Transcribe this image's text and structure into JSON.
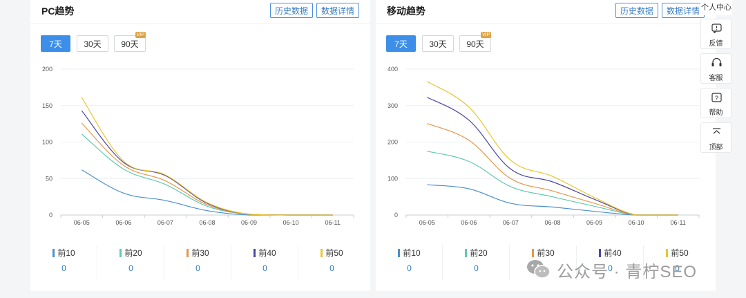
{
  "series_colors": [
    "#4a8fd1",
    "#5fcab0",
    "#e8954a",
    "#4a46a8",
    "#ecc52f"
  ],
  "panels": {
    "pc": {
      "title": "PC趋势",
      "history_button": "历史数据",
      "detail_button": "数据详情",
      "range_tabs": [
        "7天",
        "30天",
        "90天"
      ],
      "active_range": "7天",
      "vip_badge": "VIP",
      "legend": [
        {
          "name": "前10",
          "value": "0"
        },
        {
          "name": "前20",
          "value": "0"
        },
        {
          "name": "前30",
          "value": "0"
        },
        {
          "name": "前40",
          "value": "0"
        },
        {
          "name": "前50",
          "value": "0"
        }
      ]
    },
    "mobile": {
      "title": "移动趋势",
      "history_button": "历史数据",
      "detail_button": "数据详情",
      "range_tabs": [
        "7天",
        "30天",
        "90天"
      ],
      "active_range": "7天",
      "vip_badge": "VIP",
      "legend": [
        {
          "name": "前10",
          "value": "0"
        },
        {
          "name": "前20",
          "value": "0"
        },
        {
          "name": "前30",
          "value": "0"
        },
        {
          "name": "前40",
          "value": "0"
        },
        {
          "name": "前50",
          "value": "0"
        }
      ]
    }
  },
  "chart_data": [
    {
      "type": "line",
      "categories": [
        "06-05",
        "06-06",
        "06-07",
        "06-08",
        "06-09",
        "06-10",
        "06-11"
      ],
      "ylim": [
        0,
        200
      ],
      "yticks": [
        "0",
        "50",
        "100",
        "150",
        "200"
      ],
      "grid": true,
      "series": [
        {
          "name": "前10",
          "values": [
            62,
            30,
            20,
            6,
            0,
            0,
            0
          ]
        },
        {
          "name": "前20",
          "values": [
            111,
            63,
            42,
            12,
            1,
            0,
            0
          ]
        },
        {
          "name": "前30",
          "values": [
            126,
            68,
            47,
            14,
            1,
            0,
            0
          ]
        },
        {
          "name": "前40",
          "values": [
            143,
            72,
            54,
            16,
            1,
            0,
            0
          ]
        },
        {
          "name": "前50",
          "values": [
            161,
            74,
            55,
            17,
            1,
            0,
            0
          ]
        }
      ]
    },
    {
      "type": "line",
      "categories": [
        "06-05",
        "06-06",
        "06-07",
        "06-08",
        "06-09",
        "06-10",
        "06-11"
      ],
      "ylim": [
        0,
        400
      ],
      "yticks": [
        "0",
        "100",
        "200",
        "300",
        "400"
      ],
      "grid": true,
      "series": [
        {
          "name": "前10",
          "values": [
            83,
            72,
            32,
            22,
            10,
            0,
            0
          ]
        },
        {
          "name": "前20",
          "values": [
            175,
            147,
            78,
            50,
            24,
            0,
            0
          ]
        },
        {
          "name": "前30",
          "values": [
            251,
            205,
            100,
            66,
            32,
            0,
            0
          ]
        },
        {
          "name": "前40",
          "values": [
            323,
            260,
            126,
            91,
            43,
            0,
            0
          ]
        },
        {
          "name": "前50",
          "values": [
            366,
            296,
            150,
            106,
            48,
            0,
            0
          ]
        }
      ]
    }
  ],
  "side_panel": {
    "top_label": "个人中心",
    "buttons": [
      {
        "icon": "feedback-icon",
        "label": "反馈"
      },
      {
        "icon": "headset-icon",
        "label": "客服"
      },
      {
        "icon": "help-icon",
        "label": "帮助"
      },
      {
        "icon": "top-arrow-icon",
        "label": "顶部"
      }
    ]
  },
  "watermark": {
    "text": "公众号 · 青柠SEO",
    "icon": "wechat-icon"
  }
}
